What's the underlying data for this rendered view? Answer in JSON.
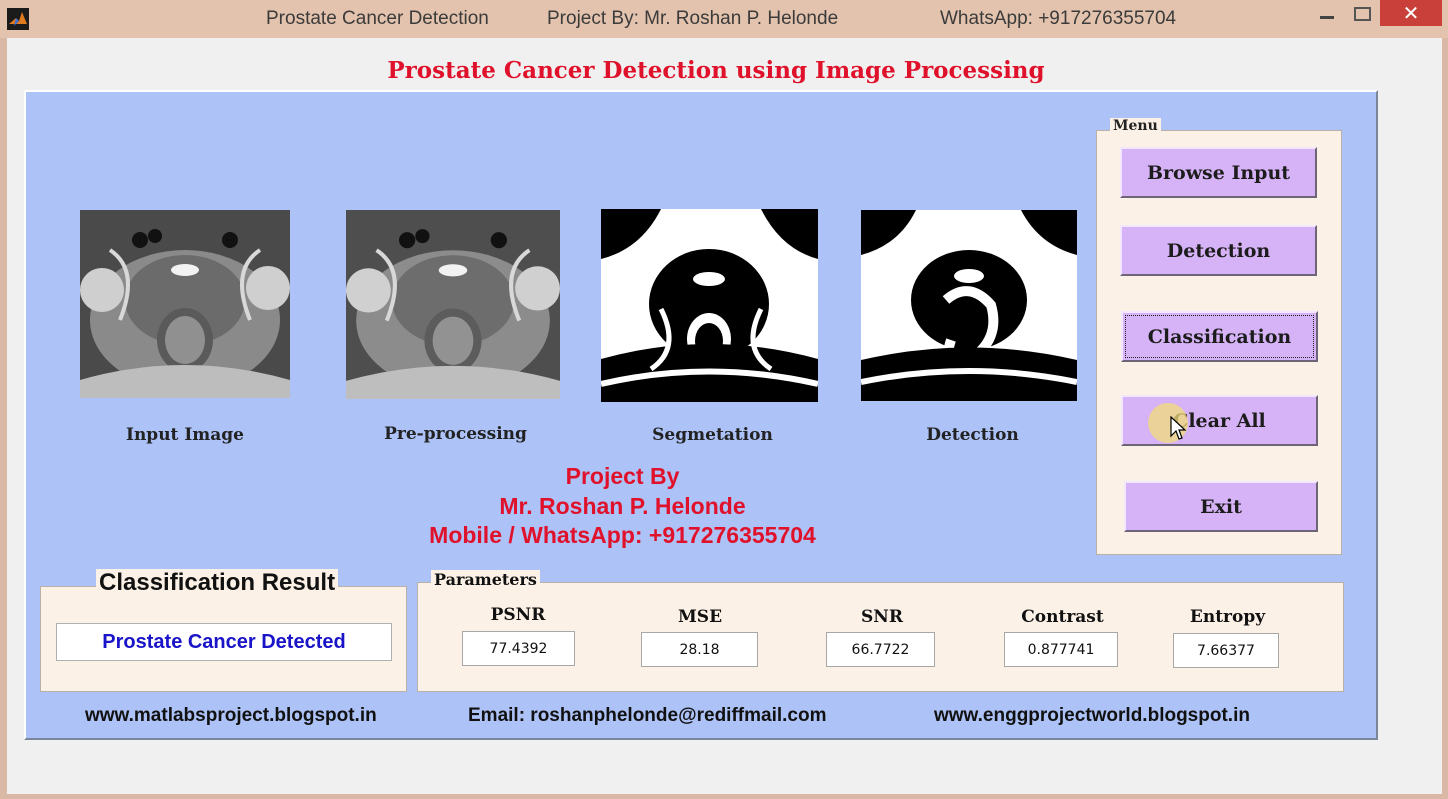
{
  "window": {
    "app_name": "Prostate Cancer Detection",
    "project_by": "Project By: Mr. Roshan P. Helonde",
    "whatsapp": "WhatsApp: +917276355704",
    "close_glyph": "✕"
  },
  "main_title": "Prostate Cancer Detection using Image Processing",
  "images": [
    {
      "label": "Input Image",
      "kind": "grayscale-mri"
    },
    {
      "label": "Pre-processing",
      "kind": "grayscale-mri"
    },
    {
      "label": "Segmetation",
      "kind": "binary-mask"
    },
    {
      "label": "Detection",
      "kind": "binary-mask"
    }
  ],
  "project_info": {
    "line1": "Project By",
    "line2": "Mr. Roshan P. Helonde",
    "line3": "Mobile / WhatsApp: +917276355704"
  },
  "menu": {
    "title": "Menu",
    "buttons": [
      "Browse Input",
      "Detection",
      "Classification",
      "Clear All",
      "Exit"
    ],
    "focused": "Classification"
  },
  "classification": {
    "title": "Classification Result",
    "value": "Prostate Cancer Detected",
    "value_color": "#1a14c9"
  },
  "parameters": {
    "title": "Parameters",
    "items": [
      {
        "label": "PSNR",
        "value": "77.4392"
      },
      {
        "label": "MSE",
        "value": "28.18"
      },
      {
        "label": "SNR",
        "value": "66.7722"
      },
      {
        "label": "Contrast",
        "value": "0.877741"
      },
      {
        "label": "Entropy",
        "value": "7.66377"
      }
    ]
  },
  "footer": {
    "left": "www.matlabsproject.blogspot.in",
    "center": "Email:  roshanphelonde@rediffmail.com",
    "right": "www.enggprojectworld.blogspot.in"
  },
  "colors": {
    "accent_red": "#e0112b",
    "panel_blue": "#adc2f7",
    "button_purple": "#d6b3f7",
    "box_cream": "#fbf1e6"
  },
  "icons": {
    "app": "matlab-icon",
    "cursor": "mouse-cursor-icon"
  }
}
